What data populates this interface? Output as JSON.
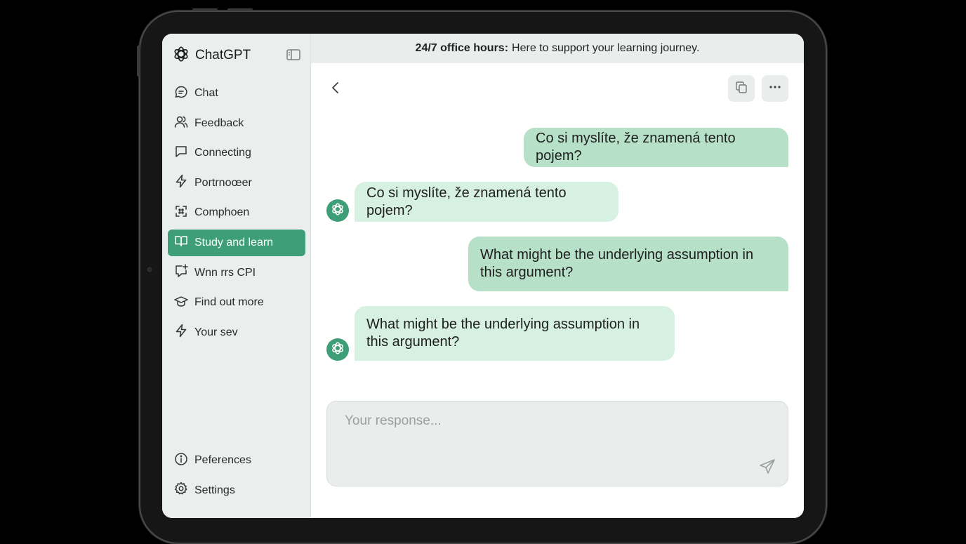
{
  "app": {
    "name": "ChatGPT",
    "accent_color": "#3d9e77",
    "user_bubble_color": "#b6e1c8",
    "bot_bubble_color": "#d6f0e1"
  },
  "sidebar": {
    "collapse_icon": "sidebar-toggle-icon",
    "items": [
      {
        "label": "Chat",
        "icon": "chat-bubble-icon",
        "active": false
      },
      {
        "label": "Feedback",
        "icon": "users-icon",
        "active": false
      },
      {
        "label": "Connecting",
        "icon": "message-square-icon",
        "active": false
      },
      {
        "label": "Portrnoœer",
        "icon": "lightning-icon",
        "active": false
      },
      {
        "label": "Comphoen",
        "icon": "scan-icon",
        "active": false
      },
      {
        "label": "Study and learn",
        "icon": "book-open-icon",
        "active": true
      },
      {
        "label": "Wnn rrs CPI",
        "icon": "message-plus-icon",
        "active": false
      },
      {
        "label": "Find out more",
        "icon": "graduation-cap-icon",
        "active": false
      },
      {
        "label": "Your sev",
        "icon": "lightning-icon",
        "active": false
      }
    ],
    "bottom_items": [
      {
        "label": "Peferences",
        "icon": "info-icon"
      },
      {
        "label": "Settings",
        "icon": "gear-icon"
      }
    ]
  },
  "banner": {
    "bold": "24/7 office hours:",
    "text": "Here to support your learning journey."
  },
  "toolbar": {
    "back_icon": "chevron-left-icon",
    "copy_icon": "copy-icon",
    "more_icon": "more-horizontal-icon"
  },
  "messages": [
    {
      "role": "user",
      "text": "Co si myslíte, že znamená tento pojem?"
    },
    {
      "role": "assistant",
      "text": "Co si myslíte, že znamená tento pojem?"
    },
    {
      "role": "user",
      "text": "What might be the underlying assumption in this argument?"
    },
    {
      "role": "assistant",
      "text": "What might be the underlying assumption in this argument?"
    }
  ],
  "composer": {
    "placeholder": "Your response...",
    "value": "",
    "send_icon": "send-icon"
  }
}
